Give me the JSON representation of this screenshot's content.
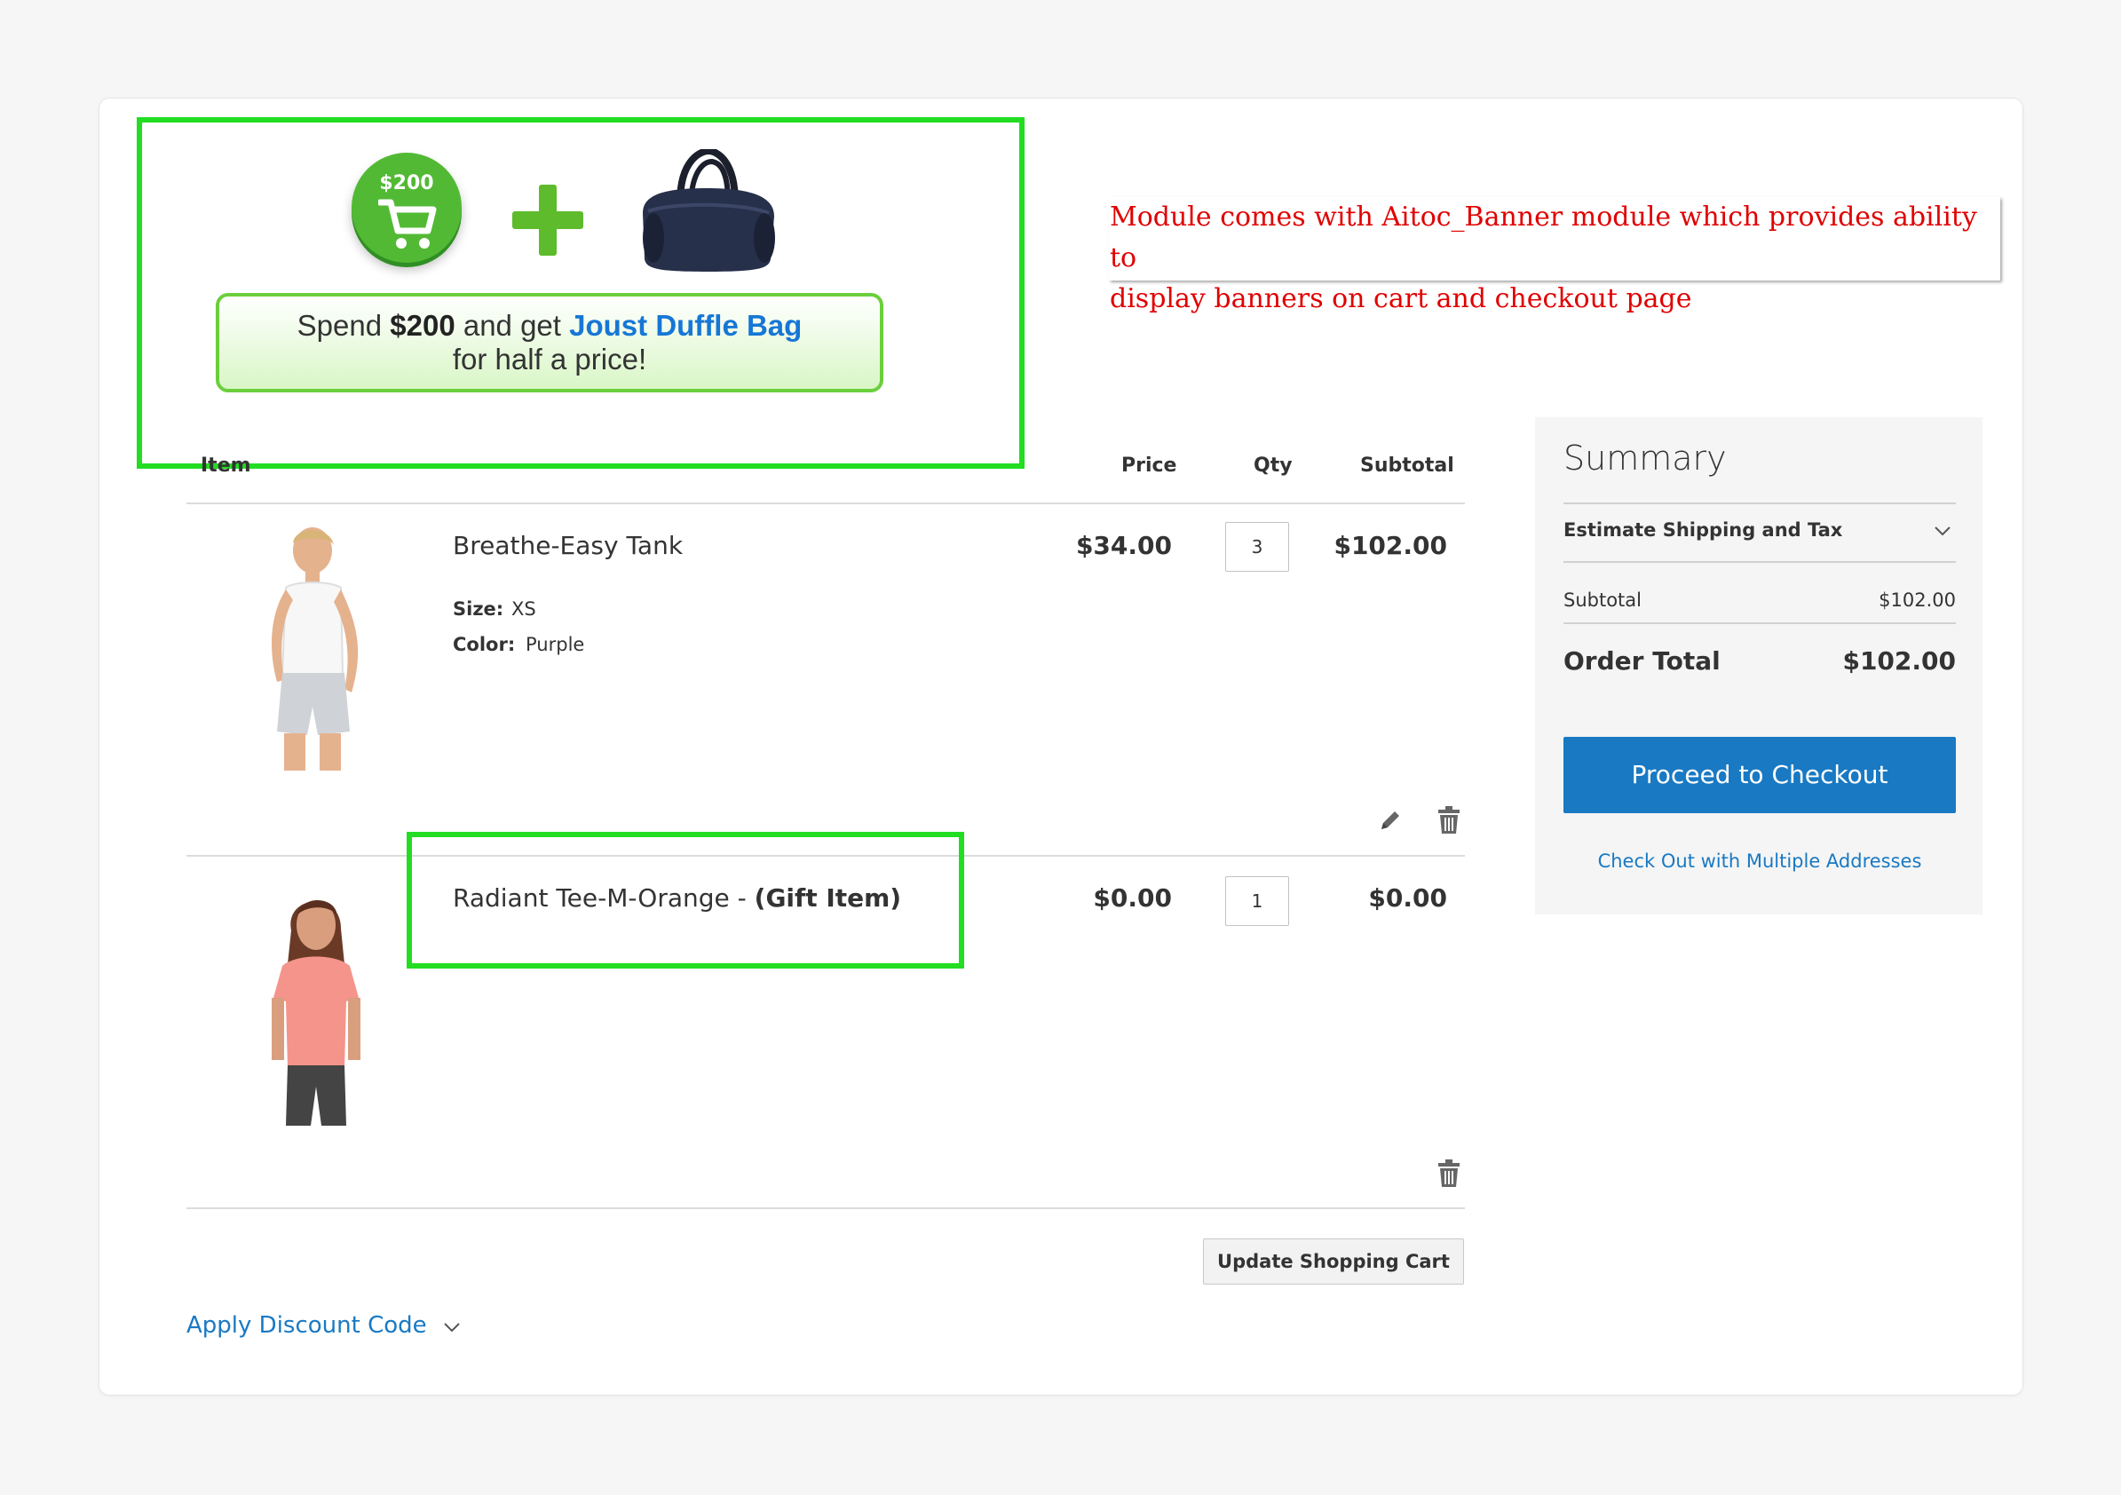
{
  "banner": {
    "badge_amount": "$200",
    "line1_prefix": "Spend ",
    "line1_amount": "$200",
    "line1_mid": " and get ",
    "line1_product": "Joust Duffle Bag",
    "line2": "for half a price!"
  },
  "note": {
    "line1": "Module comes with Aitoc_Banner module which provides ability to",
    "line2": "display banners on cart and checkout page"
  },
  "cart": {
    "headers": {
      "item": "Item",
      "price": "Price",
      "qty": "Qty",
      "subtotal": "Subtotal"
    },
    "items": [
      {
        "name": "Breathe-Easy Tank",
        "options": [
          {
            "label": "Size:",
            "value": "XS"
          },
          {
            "label": "Color:",
            "value": "Purple"
          }
        ],
        "price": "$34.00",
        "qty": "3",
        "subtotal": "$102.00"
      },
      {
        "name": "Radiant Tee-M-Orange - ",
        "gift_label": "(Gift Item)",
        "price": "$0.00",
        "qty": "1",
        "subtotal": "$0.00"
      }
    ],
    "update_button": "Update Shopping Cart",
    "discount_link": "Apply Discount Code"
  },
  "summary": {
    "title": "Summary",
    "shipping_label": "Estimate Shipping and Tax",
    "subtotal_label": "Subtotal",
    "subtotal_value": "$102.00",
    "total_label": "Order Total",
    "total_value": "$102.00",
    "checkout_button": "Proceed to Checkout",
    "multi_address_link": "Check Out with Multiple Addresses"
  },
  "colors": {
    "highlight_frame": "#22dd22",
    "accent_blue": "#1979c3",
    "note_red": "#e00000",
    "badge_green": "#52b934"
  }
}
